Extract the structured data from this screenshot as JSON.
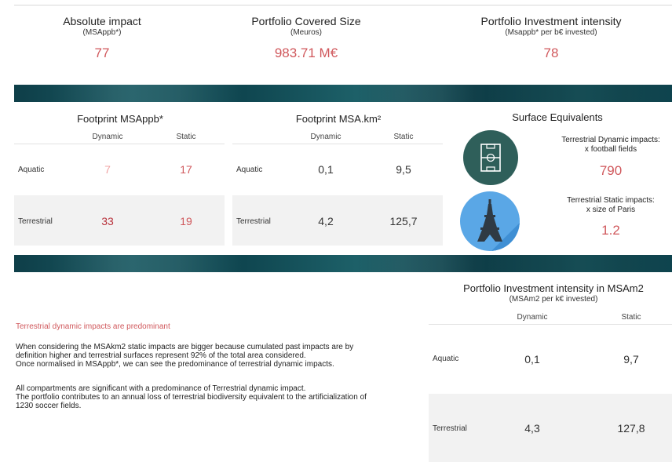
{
  "kpis": [
    {
      "title": "Absolute impact",
      "subtitle": "(MSAppb*)",
      "value": "77"
    },
    {
      "title": "Portfolio Covered Size",
      "subtitle": "(Meuros)",
      "value": "983.71 M€"
    },
    {
      "title": "Portfolio Investment intensity",
      "subtitle": "(Msappb* per b€ invested)",
      "value": "78"
    }
  ],
  "footprint_msappb": {
    "title": "Footprint MSAppb*",
    "columns": [
      "Dynamic",
      "Static"
    ],
    "rows": [
      {
        "label": "Aquatic",
        "dynamic": "7",
        "static": "17"
      },
      {
        "label": "Terrestrial",
        "dynamic": "33",
        "static": "19"
      }
    ]
  },
  "footprint_km2": {
    "title": "Footprint MSA.km²",
    "columns": [
      "Dynamic",
      "Static"
    ],
    "rows": [
      {
        "label": "Aquatic",
        "dynamic": "0,1",
        "static": "9,5"
      },
      {
        "label": "Terrestrial",
        "dynamic": "4,2",
        "static": "125,7"
      }
    ]
  },
  "surface_equivalents": {
    "title": "Surface Equivalents",
    "items": [
      {
        "line1": "Terrestrial Dynamic impacts:",
        "line2": "x football fields",
        "value": "790",
        "icon": "football-field-icon"
      },
      {
        "line1": "Terrestrial Static impacts:",
        "line2": "x size of Paris",
        "value": "1.2",
        "icon": "eiffel-tower-icon"
      }
    ]
  },
  "intensity_msam2": {
    "title": "Portfolio Investment intensity in MSAm2",
    "subtitle": "(MSAm2 per k€ invested)",
    "columns": [
      "Dynamic",
      "Static"
    ],
    "rows": [
      {
        "label": "Aquatic",
        "dynamic": "0,1",
        "static": "9,7"
      },
      {
        "label": "Terrestrial",
        "dynamic": "4,3",
        "static": "127,8"
      }
    ]
  },
  "commentary": {
    "title": "Terrestrial dynamic impacts are predominant",
    "p1": [
      "When considering the MSAkm2 static impacts are bigger because cumulated past impacts are by",
      "definition higher and terrestrial surfaces represent 92% of the total area considered.",
      "Once normalised in MSAppb*, we can see the predominance of terrestrial dynamic impacts."
    ],
    "p2": [
      "All compartments are significant with a predominance of Terrestrial dynamic impact.",
      "The portfolio contributes to an annual loss of terrestrial biodiversity equivalent to the artificialization of",
      "1230 soccer fields."
    ]
  },
  "colors": {
    "accent": "#d0585c",
    "band": "#0f4650",
    "football_circle": "#2f5f5a",
    "paris_circle": "#5aa7e6"
  }
}
